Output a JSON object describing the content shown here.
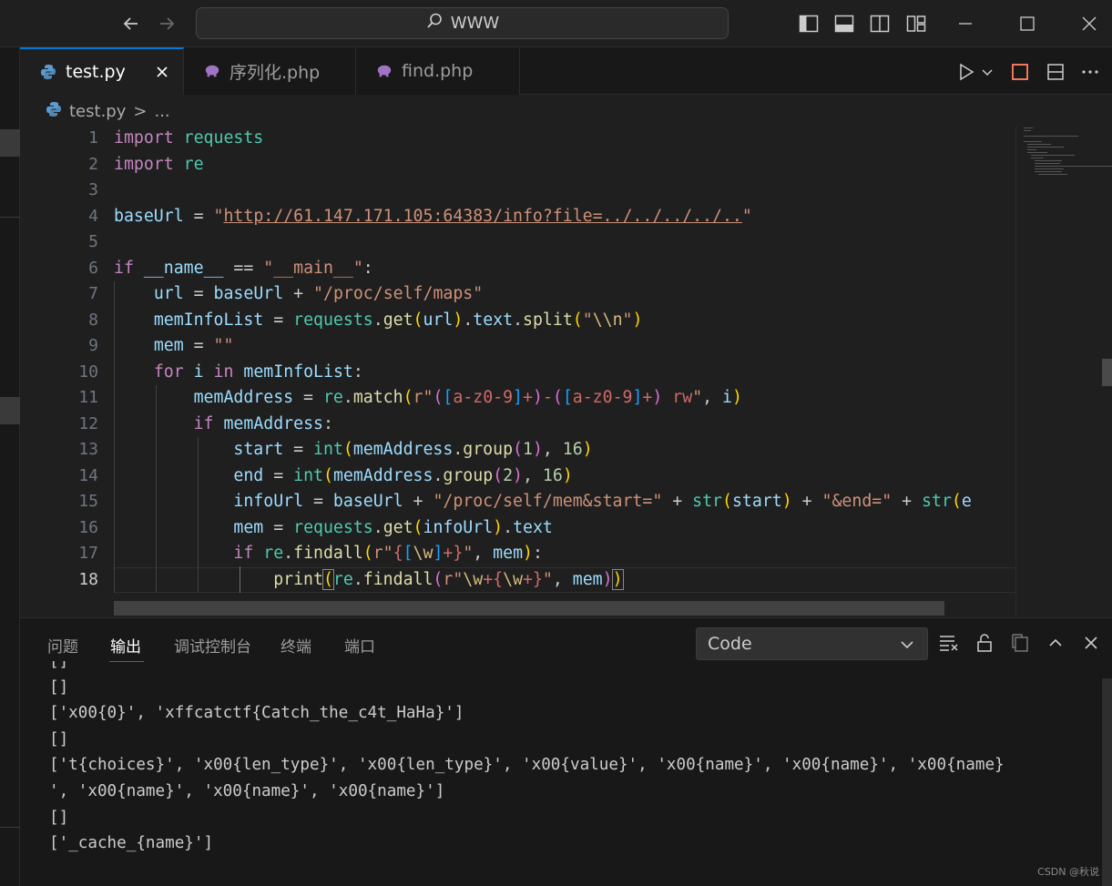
{
  "title_bar": {
    "search_text": "WWW",
    "back_icon": "arrow-left-icon",
    "forward_icon": "arrow-right-icon",
    "layout_icons": [
      "toggle-primary-sidebar-icon",
      "toggle-panel-icon",
      "toggle-secondary-sidebar-icon",
      "customize-layout-icon"
    ],
    "window_controls": [
      "minimize-icon",
      "maximize-icon",
      "close-icon"
    ]
  },
  "tabs": [
    {
      "label": "test.py",
      "icon": "python-icon",
      "active": true
    },
    {
      "label": "序列化.php",
      "icon": "php-elephant-icon",
      "active": false
    },
    {
      "label": "find.php",
      "icon": "php-elephant-icon",
      "active": false
    }
  ],
  "editor_actions": [
    "run-icon",
    "run-dropdown-icon",
    "stop-icon",
    "split-editor-icon",
    "more-actions-icon"
  ],
  "breadcrumb": {
    "file": "test.py",
    "separator": ">",
    "rest": "..."
  },
  "editor": {
    "current_line": 18,
    "line_numbers": [
      "1",
      "2",
      "3",
      "4",
      "5",
      "6",
      "7",
      "8",
      "9",
      "10",
      "11",
      "12",
      "13",
      "14",
      "15",
      "16",
      "17",
      "18"
    ]
  },
  "panel": {
    "tabs": [
      {
        "label": "问题",
        "active": false
      },
      {
        "label": "输出",
        "active": true
      },
      {
        "label": "调试控制台",
        "active": false
      },
      {
        "label": "终端",
        "active": false
      },
      {
        "label": "端口",
        "active": false
      }
    ],
    "output_channel": "Code",
    "actions": [
      "clear-output-icon",
      "lock-scroll-icon",
      "open-output-editor-icon",
      "maximize-panel-icon",
      "close-panel-icon"
    ],
    "output_lines": [
      "[]",
      "[]",
      "['x00{0}', 'xffcatctf{Catch_the_c4t_HaHa}']",
      "[]",
      "['t{choices}', 'x00{len_type}', 'x00{len_type}', 'x00{value}', 'x00{name}', 'x00{name}', 'x00{name}",
      "', 'x00{name}', 'x00{name}', 'x00{name}']",
      "[]",
      "['_cache_{name}']"
    ]
  },
  "watermark": "CSDN @秋说",
  "colors": {
    "accent": "#0078d4",
    "keyword": "#c586c0",
    "string": "#ce9178",
    "function": "#dcdcaa",
    "variable": "#9cdcfe",
    "module": "#4ec9b0",
    "number": "#b5cea8"
  }
}
